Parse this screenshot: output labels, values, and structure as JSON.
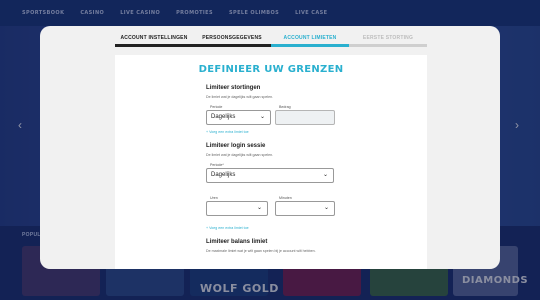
{
  "site": {
    "nav": [
      "SPORTSBOOK",
      "CASINO",
      "LIVE CASINO",
      "PROMOTIES",
      "SPELE OLIMBOS",
      "LIVE CASE"
    ],
    "row_label": "POPULAR",
    "tiles": [
      {
        "text": "",
        "color": "#4a3a6a"
      },
      {
        "text": "",
        "color": "#2d4b88"
      },
      {
        "text": "WOLF GOLD",
        "color": "#1d3f7a"
      },
      {
        "text": "",
        "color": "#7a1e4a"
      },
      {
        "text": "",
        "color": "#3c6a3e"
      },
      {
        "text": "",
        "color": "#5c6a9a"
      },
      {
        "text": "DIAMONDS",
        "color": "#3a7ab6"
      }
    ]
  },
  "modal": {
    "steps": [
      {
        "label": "ACCOUNT INSTELLINGEN",
        "state": "done"
      },
      {
        "label": "PERSOONSGEGEVENS",
        "state": "done"
      },
      {
        "label": "ACCOUNT LIMIETEN",
        "state": "active"
      },
      {
        "label": "EERSTE STORTING",
        "state": "todo"
      }
    ],
    "heading": "DEFINIEER UW GRENZEN",
    "deposit": {
      "title": "Limiteer stortingen",
      "desc": "De limiet wat je dagelijks wilt gaan spelen.",
      "period_label": "Periode",
      "period_value": "Dagelijks",
      "amount_label": "Bedrag",
      "amount_value": "",
      "add_link": "+ Voeg een extra limiet toe"
    },
    "login": {
      "title": "Limiteer login sessie",
      "desc": "De limiet wat je dagelijks wilt gaan spelen.",
      "period_label": "Periode*",
      "period_value": "Dagelijks",
      "hours_label": "Uren",
      "hours_value": "",
      "minutes_label": "Minuten",
      "minutes_value": "",
      "add_link": "+ Voeg een extra limiet toe"
    },
    "balance": {
      "title": "Limiteer balans limiet",
      "desc": "De maximale limiet wat je wilt gaan spelen bij je account wilt hebben."
    }
  },
  "colors": {
    "accent": "#2ab0cf",
    "background": "#1f3d86"
  },
  "icons": {
    "chevron": "chevron-down-icon",
    "prev": "chevron-left-icon",
    "next": "chevron-right-icon"
  }
}
